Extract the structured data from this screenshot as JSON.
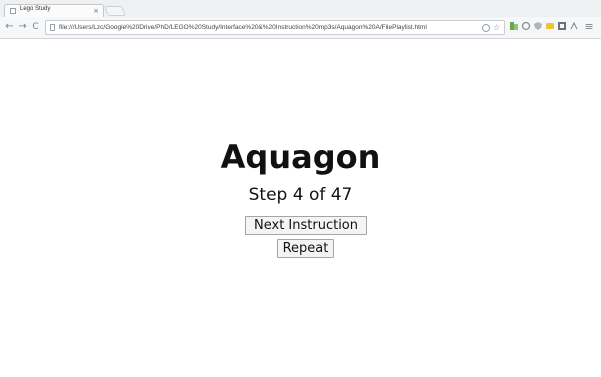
{
  "browser": {
    "tab": {
      "title": "Lego Study",
      "close_glyph": "×",
      "favicon": "page-icon"
    },
    "toolbar": {
      "back_glyph": "←",
      "forward_glyph": "→",
      "reload_glyph": "C",
      "url": "file:///Users/Lzc/Google%20Drive/PhD/LEGO%20Study/Interface%20&%20Instruction%20mp3s/Aquagon%20A/FilePlaylist.html",
      "bookmark_star_glyph": "☆",
      "menu_glyph": "≡",
      "extension_icons": [
        "zoom-icon",
        "extension-green-icon",
        "extension-circle-icon",
        "extension-shield-icon",
        "extension-yellow-icon",
        "extension-puzzle-icon",
        "extension-reader-icon"
      ]
    }
  },
  "page": {
    "title": "Aquagon",
    "step_text": "Step 4 of 47",
    "next_button_label": "Next Instruction",
    "repeat_button_label": "Repeat"
  }
}
